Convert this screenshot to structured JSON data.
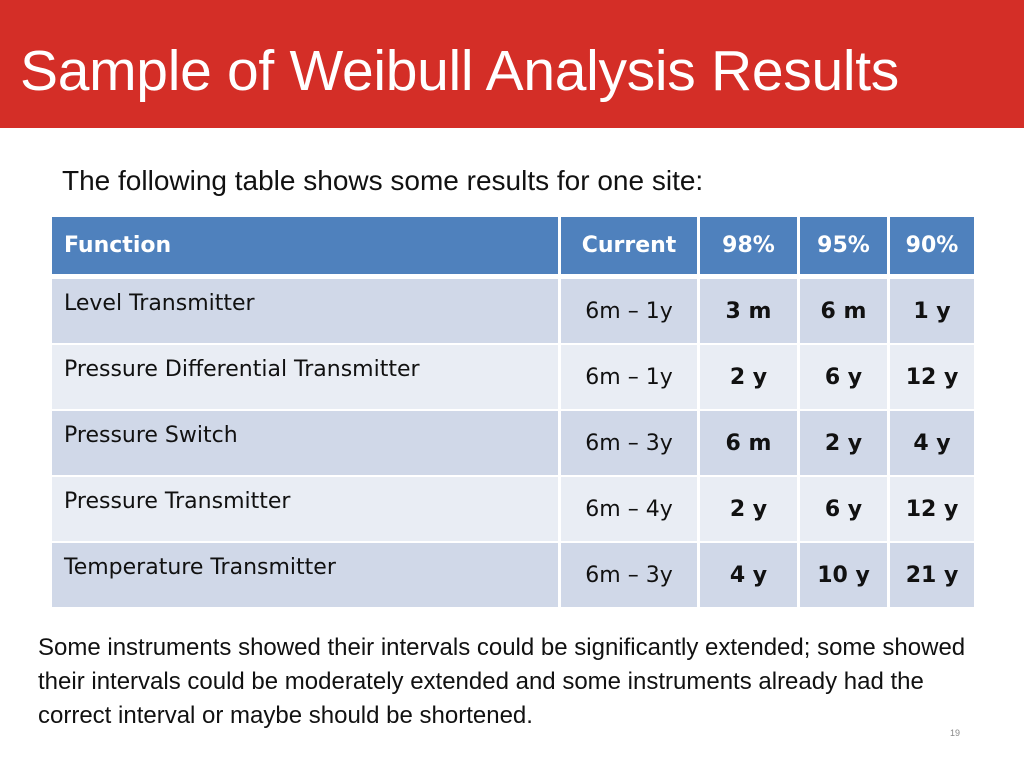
{
  "slide": {
    "title": "Sample of Weibull Analysis Results",
    "intro": "The following table shows some results for one site:",
    "summary": "Some instruments showed their intervals could be significantly extended; some showed their intervals could be moderately extended and some instruments already had the correct interval or maybe should be shortened.",
    "page_number": "19",
    "colors": {
      "title_bar": "#d42e27",
      "header": "#4f81bd",
      "row_odd": "#d0d8e8",
      "row_even": "#e9edf4"
    }
  },
  "table": {
    "headers": [
      "Function",
      "Current",
      "98%",
      "95%",
      "90%"
    ],
    "rows": [
      {
        "function": "Level Transmitter",
        "current": "6m – 1y",
        "p98": "3 m",
        "p95": "6 m",
        "p90": "1 y"
      },
      {
        "function": "Pressure Differential Transmitter",
        "current": "6m – 1y",
        "p98": "2 y",
        "p95": "6 y",
        "p90": "12 y"
      },
      {
        "function": "Pressure Switch",
        "current": "6m – 3y",
        "p98": "6 m",
        "p95": "2 y",
        "p90": "4 y"
      },
      {
        "function": "Pressure Transmitter",
        "current": "6m – 4y",
        "p98": "2 y",
        "p95": "6 y",
        "p90": "12 y"
      },
      {
        "function": "Temperature Transmitter",
        "current": "6m – 3y",
        "p98": "4 y",
        "p95": "10 y",
        "p90": "21 y"
      }
    ]
  }
}
